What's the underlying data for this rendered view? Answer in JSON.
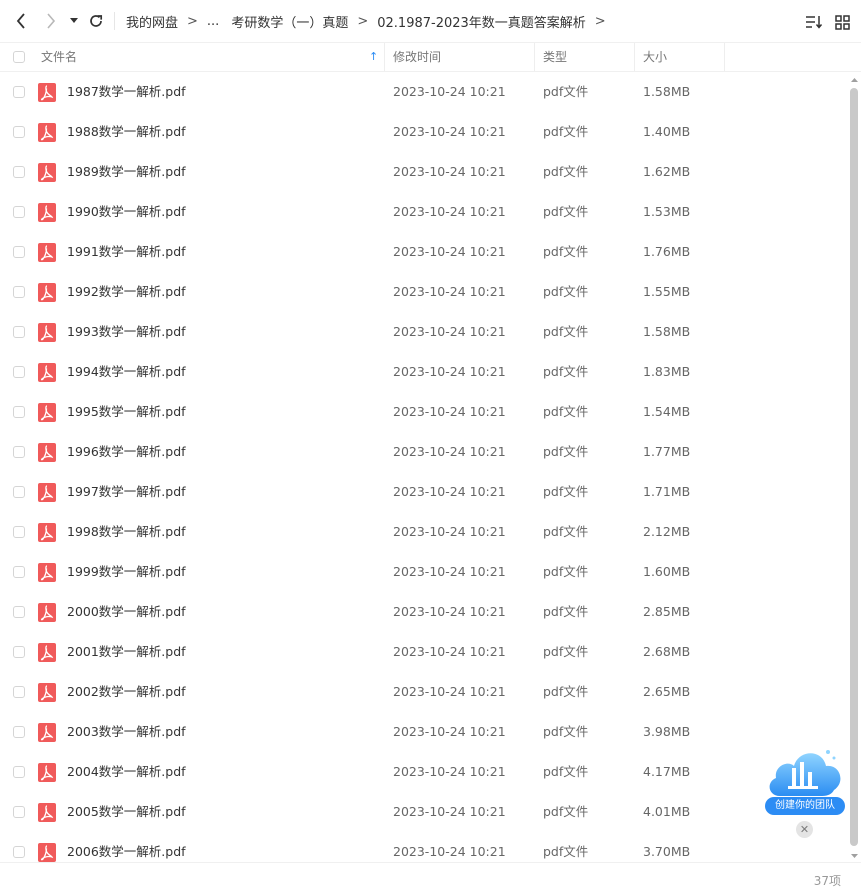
{
  "breadcrumb": [
    "我的网盘",
    "...",
    "考研数学（一）真题",
    "02.1987-2023年数一真题答案解析"
  ],
  "breadcrumb_separator": ">",
  "columns": {
    "name": "文件名",
    "modified": "修改时间",
    "type": "类型",
    "size": "大小"
  },
  "sort_indicator": "↑",
  "files": [
    {
      "name": "1987数学一解析.pdf",
      "modified": "2023-10-24 10:21",
      "type": "pdf文件",
      "size": "1.58MB"
    },
    {
      "name": "1988数学一解析.pdf",
      "modified": "2023-10-24 10:21",
      "type": "pdf文件",
      "size": "1.40MB"
    },
    {
      "name": "1989数学一解析.pdf",
      "modified": "2023-10-24 10:21",
      "type": "pdf文件",
      "size": "1.62MB"
    },
    {
      "name": "1990数学一解析.pdf",
      "modified": "2023-10-24 10:21",
      "type": "pdf文件",
      "size": "1.53MB"
    },
    {
      "name": "1991数学一解析.pdf",
      "modified": "2023-10-24 10:21",
      "type": "pdf文件",
      "size": "1.76MB"
    },
    {
      "name": "1992数学一解析.pdf",
      "modified": "2023-10-24 10:21",
      "type": "pdf文件",
      "size": "1.55MB"
    },
    {
      "name": "1993数学一解析.pdf",
      "modified": "2023-10-24 10:21",
      "type": "pdf文件",
      "size": "1.58MB"
    },
    {
      "name": "1994数学一解析.pdf",
      "modified": "2023-10-24 10:21",
      "type": "pdf文件",
      "size": "1.83MB"
    },
    {
      "name": "1995数学一解析.pdf",
      "modified": "2023-10-24 10:21",
      "type": "pdf文件",
      "size": "1.54MB"
    },
    {
      "name": "1996数学一解析.pdf",
      "modified": "2023-10-24 10:21",
      "type": "pdf文件",
      "size": "1.77MB"
    },
    {
      "name": "1997数学一解析.pdf",
      "modified": "2023-10-24 10:21",
      "type": "pdf文件",
      "size": "1.71MB"
    },
    {
      "name": "1998数学一解析.pdf",
      "modified": "2023-10-24 10:21",
      "type": "pdf文件",
      "size": "2.12MB"
    },
    {
      "name": "1999数学一解析.pdf",
      "modified": "2023-10-24 10:21",
      "type": "pdf文件",
      "size": "1.60MB"
    },
    {
      "name": "2000数学一解析.pdf",
      "modified": "2023-10-24 10:21",
      "type": "pdf文件",
      "size": "2.85MB"
    },
    {
      "name": "2001数学一解析.pdf",
      "modified": "2023-10-24 10:21",
      "type": "pdf文件",
      "size": "2.68MB"
    },
    {
      "name": "2002数学一解析.pdf",
      "modified": "2023-10-24 10:21",
      "type": "pdf文件",
      "size": "2.65MB"
    },
    {
      "name": "2003数学一解析.pdf",
      "modified": "2023-10-24 10:21",
      "type": "pdf文件",
      "size": "3.98MB"
    },
    {
      "name": "2004数学一解析.pdf",
      "modified": "2023-10-24 10:21",
      "type": "pdf文件",
      "size": "4.17MB"
    },
    {
      "name": "2005数学一解析.pdf",
      "modified": "2023-10-24 10:21",
      "type": "pdf文件",
      "size": "4.01MB"
    },
    {
      "name": "2006数学一解析.pdf",
      "modified": "2023-10-24 10:21",
      "type": "pdf文件",
      "size": "3.70MB"
    }
  ],
  "item_count": "37项",
  "team_widget": {
    "label": "创建你的团队",
    "close": "✕"
  },
  "colors": {
    "accent": "#2c8cf4",
    "pdf_icon": "#f05a5a"
  }
}
